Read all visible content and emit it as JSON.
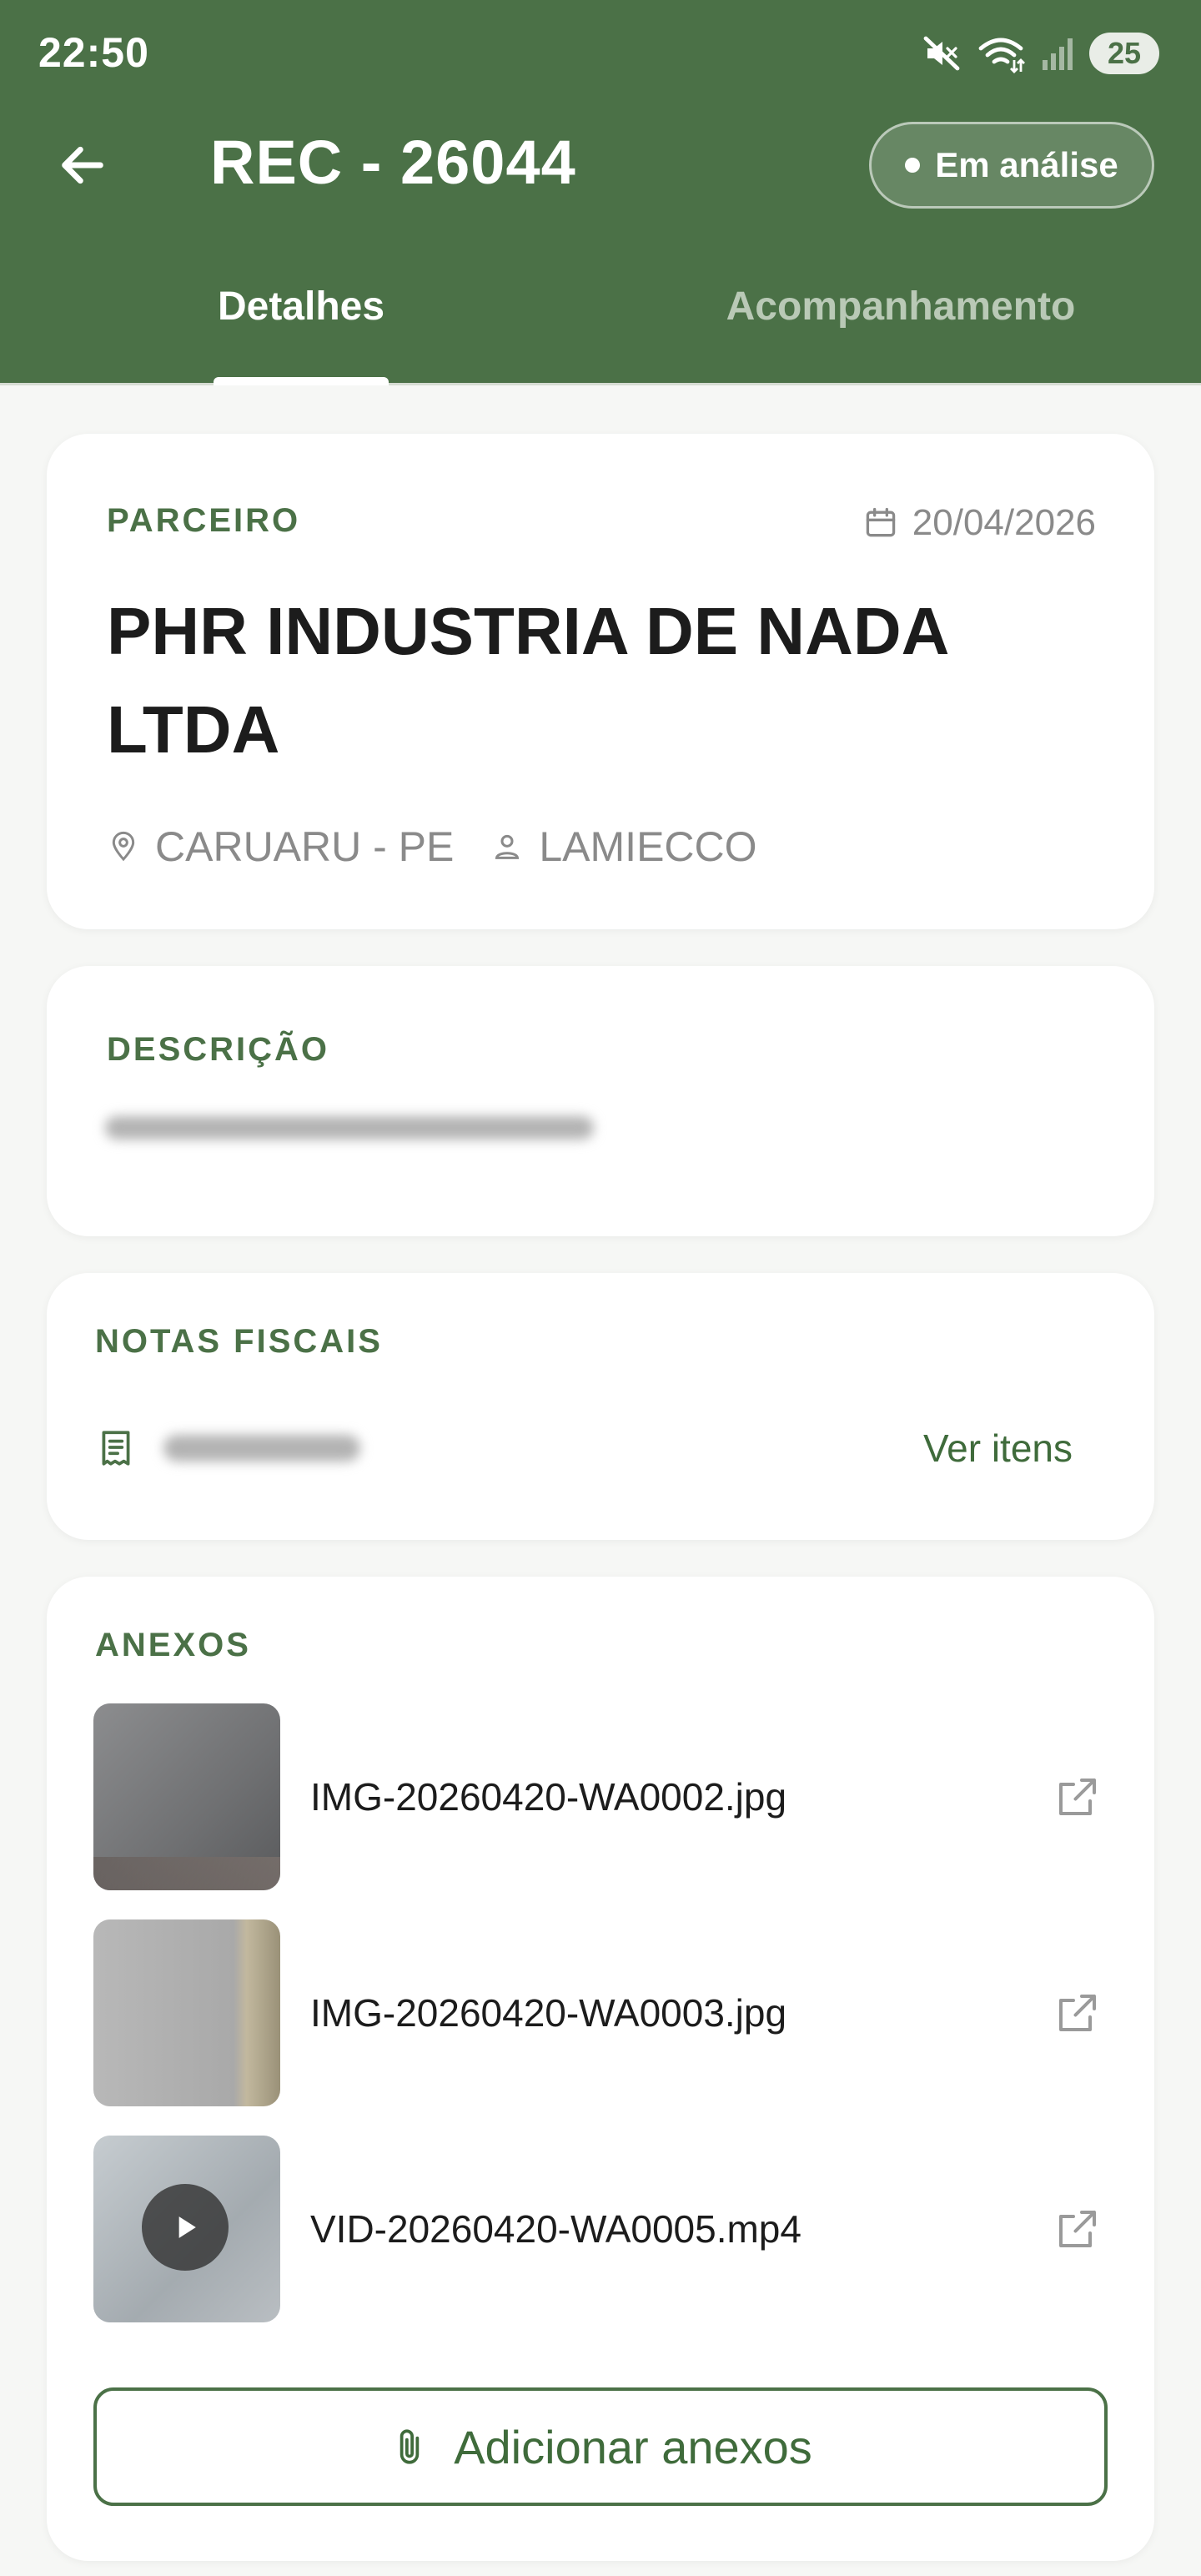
{
  "status_bar": {
    "time": "22:50",
    "icons": [
      "mute-icon",
      "wifi-icon",
      "signal-icon"
    ],
    "battery": "25"
  },
  "header": {
    "title": "REC - 26044",
    "status_chip": "Em análise",
    "back_icon": "arrow-left-icon"
  },
  "tabs": [
    {
      "label": "Detalhes",
      "active": true
    },
    {
      "label": "Acompanhamento",
      "active": false
    }
  ],
  "partner_card": {
    "section_label": "PARCEIRO",
    "date": "20/04/2026",
    "name": "PHR INDUSTRIA DE NADA LTDA",
    "location": "CARUARU - PE",
    "user": "LAMIECCO"
  },
  "description_card": {
    "section_label": "DESCRIÇÃO"
  },
  "invoices_card": {
    "section_label": "NOTAS FISCAIS",
    "action_label": "Ver itens"
  },
  "attachments_card": {
    "section_label": "ANEXOS",
    "files": [
      {
        "name": "IMG-20260420-WA0002.jpg",
        "type": "image"
      },
      {
        "name": "IMG-20260420-WA0003.jpg",
        "type": "image"
      },
      {
        "name": "VID-20260420-WA0005.mp4",
        "type": "video"
      }
    ],
    "add_button_label": "Adicionar anexos"
  },
  "colors": {
    "primary": "#4b7147",
    "accent_text": "#3f6b3b",
    "background": "#f6f7f5",
    "muted_text": "#8a8a8a"
  }
}
